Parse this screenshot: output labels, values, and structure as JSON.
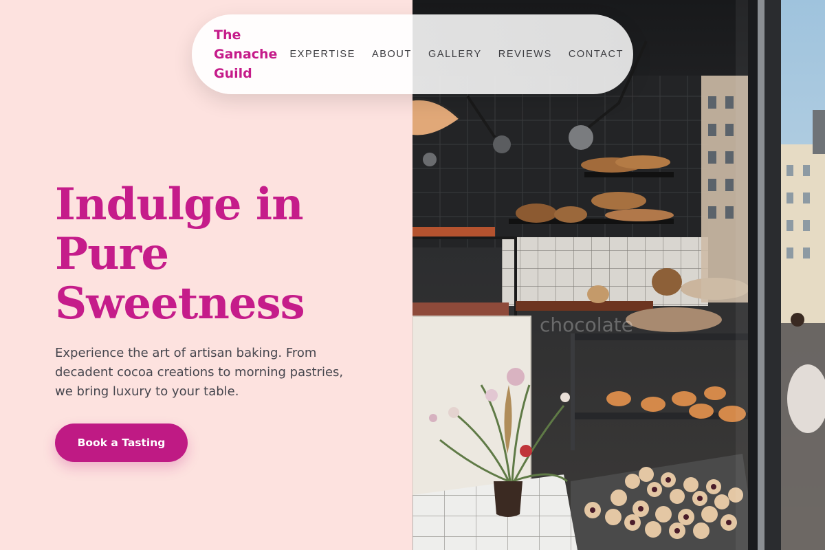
{
  "brand": {
    "name_lines": [
      "The",
      "Ganache",
      "Guild"
    ]
  },
  "nav": {
    "items": [
      {
        "label": "EXPERTISE"
      },
      {
        "label": "ABOUT"
      },
      {
        "label": "GALLERY"
      },
      {
        "label": "REVIEWS"
      },
      {
        "label": "CONTACT"
      }
    ]
  },
  "hero": {
    "title_lines": [
      "Indulge in",
      "Pure",
      "Sweetness"
    ],
    "subtitle": "Experience the art of artisan baking. From decadent cocoa creations to morning pastries, we bring luxury to your table.",
    "cta_label": "Book a Tasting"
  },
  "photo": {
    "reflection_text": "chocolate"
  },
  "colors": {
    "accent": "#c51c8a",
    "button": "#bf1a84",
    "background": "#fde2df",
    "nav_text": "#3c3c40",
    "body_text": "#45454d"
  }
}
